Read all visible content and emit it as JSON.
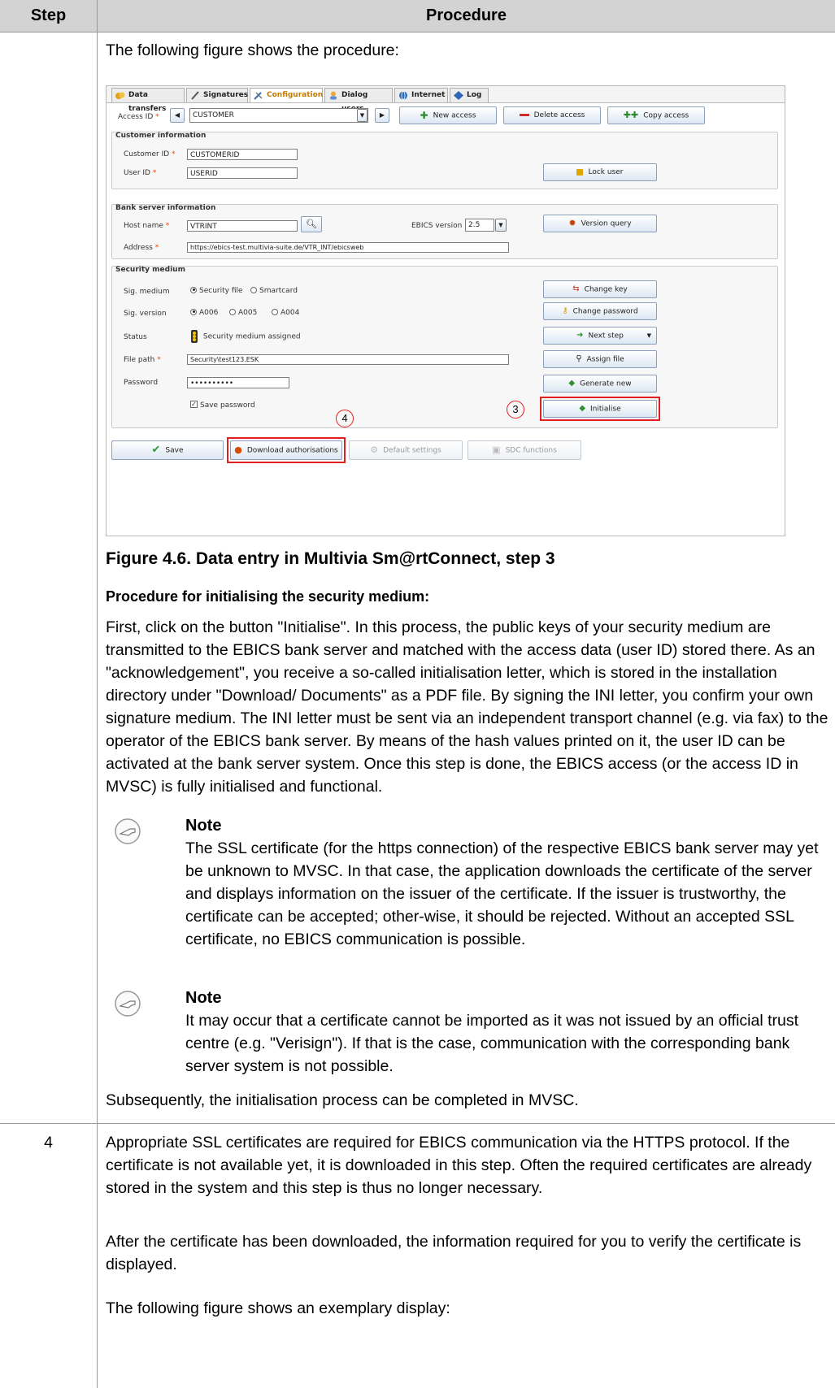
{
  "table": {
    "header_step": "Step",
    "header_procedure": "Procedure"
  },
  "intro": "The following figure shows the procedure:",
  "screenshot": {
    "tabs": [
      "Data transfers",
      "Signatures",
      "Configuration",
      "Dialog users",
      "Internet",
      "Log"
    ],
    "active_tab": "Configuration",
    "access_id_label": "Access ID",
    "access_id_value": "CUSTOMER",
    "new_access": "New access",
    "delete_access": "Delete access",
    "copy_access": "Copy access",
    "customer_info": {
      "title": "Customer information",
      "customer_id_label": "Customer ID",
      "customer_id_value": "CUSTOMERID",
      "user_id_label": "User ID",
      "user_id_value": "USERID",
      "lock_user": "Lock user"
    },
    "bank_server": {
      "title": "Bank server information",
      "host_label": "Host name",
      "host_value": "VTRINT",
      "ebics_version_label": "EBICS version",
      "ebics_version_value": "2.5",
      "version_query": "Version query",
      "address_label": "Address",
      "address_value": "https://ebics-test.multivia-suite.de/VTR_INT/ebicsweb"
    },
    "security": {
      "title": "Security medium",
      "sig_medium_label": "Sig. medium",
      "sig_medium_opt1": "Security file",
      "sig_medium_opt2": "Smartcard",
      "sig_version_label": "Sig. version",
      "sig_version_opts": [
        "A006",
        "A005",
        "A004"
      ],
      "status_label": "Status",
      "status_value": "Security medium assigned",
      "file_path_label": "File path",
      "file_path_value": "Security\\test123.ESK",
      "password_label": "Password",
      "password_value": "••••••••••",
      "save_password": "Save password",
      "change_key": "Change key",
      "change_password": "Change password",
      "next_step": "Next step",
      "assign_file": "Assign file",
      "generate_new": "Generate new",
      "initialise": "Initialise"
    },
    "bottom": {
      "save": "Save",
      "download_auth": "Download authorisations",
      "default_settings": "Default settings",
      "sdc_functions": "SDC functions"
    },
    "markers": [
      "4",
      "3"
    ]
  },
  "figure_caption": "Figure 4.6. Data entry in Multivia Sm@rtConnect, step 3",
  "init_heading": "Procedure for initialising the security medium:",
  "init_paragraph": "First, click on the button \"Initialise\". In this process, the public keys of your security medium are transmitted to the EBICS bank server and matched with the access data (user ID) stored there. As an \"acknowledgement\", you receive a so-called initialisation letter, which is stored in the installation directory under \"Download/ Documents\" as a PDF file. By signing the INI letter, you confirm your own signature medium. The INI letter must be sent via an independent transport channel (e.g. via fax) to the operator of the EBICS bank server. By means of the hash values printed on it, the user ID can be activated at the bank server system. Once this step is done, the EBICS access (or the access ID in MVSC) is fully initialised and functional.",
  "note1": {
    "title": "Note",
    "text": "The SSL certificate (for the https connection) of the respective EBICS bank server may yet be unknown to MVSC. In that case, the application downloads the certificate of the server and displays information on the issuer of the certificate. If the issuer is trustworthy, the certificate can be accepted; other-wise, it should be rejected. Without an accepted SSL certificate, no EBICS communication is possible."
  },
  "note2": {
    "title": "Note",
    "text": "It may occur that a certificate cannot be imported as it was not issued by an official trust centre (e.g. \"Verisign\"). If that is the case, communication with the corresponding bank server system is not possible."
  },
  "subsequently": "Subsequently, the initialisation process can be completed in MVSC.",
  "step4": {
    "number": "4",
    "p1": "Appropriate SSL certificates are required for EBICS communication via the HTTPS protocol. If the certificate is not available yet, it is downloaded in this step. Often the required certificates are already stored in the system and this step is thus no longer necessary.",
    "p2": "After the certificate has been downloaded, the information required for you to verify the certificate is displayed.",
    "p3": "The following figure shows an exemplary display:"
  }
}
